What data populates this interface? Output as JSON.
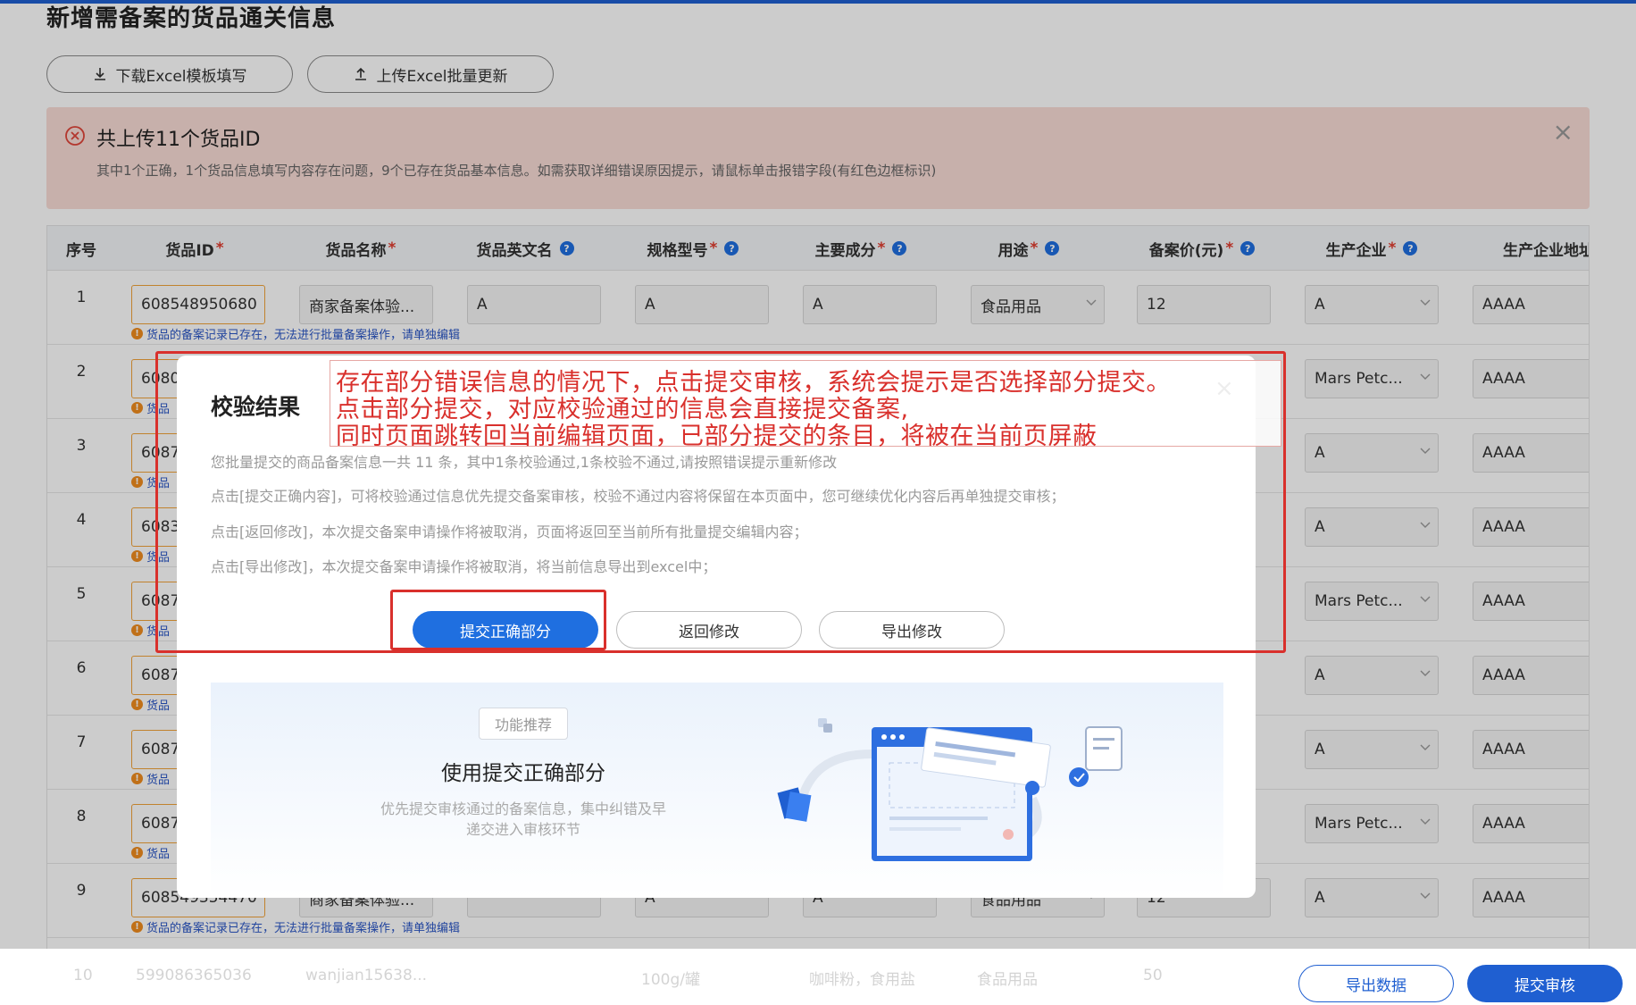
{
  "page": {
    "title": "新增需备案的货品通关信息"
  },
  "toolbar": {
    "download_label": "下载Excel模板填写",
    "upload_label": "上传Excel批量更新"
  },
  "banner": {
    "title": "共上传11个货品ID",
    "desc": "其中1个正确，1个货品信息填写内容存在问题，9个已存在货品基本信息。如需获取详细错误原因提示，请鼠标单击报错字段(有红色边框标识)",
    "close": "×"
  },
  "table": {
    "headers": [
      "序号",
      "货品ID",
      "货品名称",
      "货品英文名",
      "规格型号",
      "主要成分",
      "用途",
      "备案价(元)",
      "生产企业",
      "生产企业地址"
    ],
    "req_mark": "*",
    "warn_text": "货品的备案记录已存在，无法进行批量备案操作，请单独编辑",
    "warn_short": "货品",
    "rows": [
      {
        "seq": "1",
        "id": "608548950680",
        "name": "商家备案体验...",
        "en": "A",
        "spec": "A",
        "comp": "A",
        "use": "食品用品",
        "price": "12",
        "maker": "A",
        "addr": "AAAA"
      },
      {
        "seq": "2",
        "id": "6080",
        "maker": "Mars Petc...",
        "addr": "AAAA"
      },
      {
        "seq": "3",
        "id": "6087",
        "maker": "A",
        "addr": "AAAA"
      },
      {
        "seq": "4",
        "id": "6083",
        "maker": "A",
        "addr": "AAAA"
      },
      {
        "seq": "5",
        "id": "6087",
        "maker": "Mars Petc...",
        "addr": "AAAA"
      },
      {
        "seq": "6",
        "id": "6087",
        "maker": "A",
        "addr": "AAAA"
      },
      {
        "seq": "7",
        "id": "6087",
        "maker": "A",
        "addr": "AAAA"
      },
      {
        "seq": "8",
        "id": "6087",
        "maker": "Mars Petc...",
        "addr": "AAAA"
      },
      {
        "seq": "9",
        "id": "608549354470",
        "name": "商家备案体验...",
        "en": "",
        "spec": "A",
        "comp": "A",
        "use": "食品用品",
        "price": "12",
        "maker": "A",
        "addr": "AAAA"
      }
    ],
    "ghost_row": {
      "seq": "10",
      "id": "599086365036",
      "name": "wanjian15638...",
      "spec": "100g/罐",
      "comp": "咖啡粉，食用盐",
      "use": "食品用品",
      "price": "50"
    }
  },
  "footer": {
    "export_label": "导出数据",
    "submit_label": "提交审核"
  },
  "modal": {
    "title": "校验结果",
    "lines": [
      "您批量提交的商品备案信息一共 11 条，其中1条校验通过,1条校验不通过,请按照错误提示重新修改",
      "点击[提交正确内容]，可将校验通过信息优先提交备案审核，校验不通过内容将保留在本页面中，您可继续优化内容后再单独提交审核；",
      "点击[返回修改]，本次提交备案申请操作将被取消，页面将返回至当前所有批量提交编辑内容；",
      "点击[导出修改]，本次提交备案申请操作将被取消，将当前信息导出到excel中；"
    ],
    "btn_submit": "提交正确部分",
    "btn_return": "返回修改",
    "btn_export": "导出修改",
    "close": "×",
    "feature": {
      "tag": "功能推荐",
      "title": "使用提交正确部分",
      "desc_1": "优先提交审核通过的备案信息，集中纠错及早",
      "desc_2": "递交进入审核环节"
    }
  },
  "annotation": {
    "line_1": "存在部分错误信息的情况下，点击提交审核，系统会提示是否选择部分提交。",
    "line_2": "点击部分提交，对应校验通过的信息会直接提交备案,",
    "line_3": "同时页面跳转回当前编辑页面，已部分提交的条目，将被在当前页屏蔽"
  },
  "colors": {
    "primary": "#1f6fe0",
    "annotation": "#d9302c",
    "banner_bg": "#f9dcd6",
    "warn": "#f08c1e"
  }
}
